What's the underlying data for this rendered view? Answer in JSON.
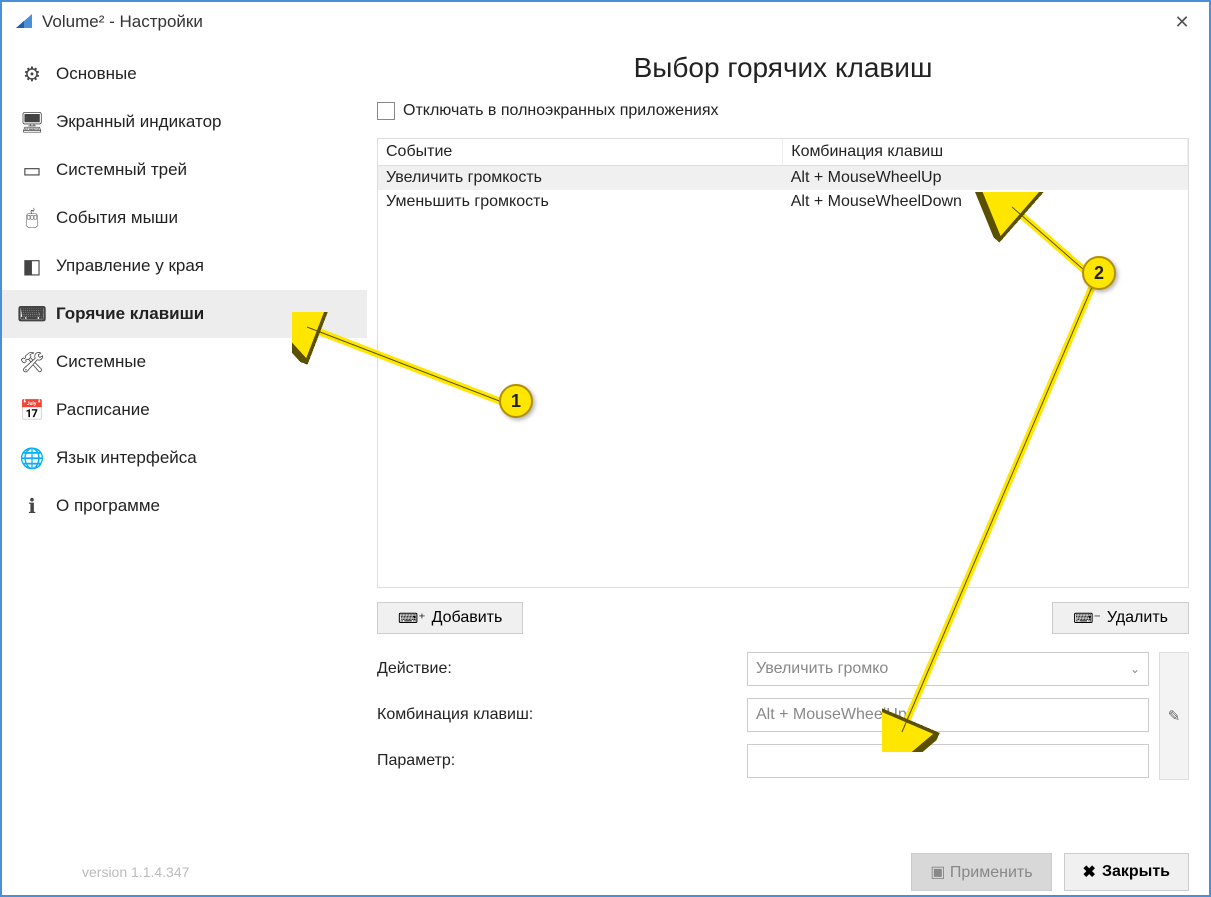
{
  "window": {
    "title": "Volume² - Настройки"
  },
  "sidebar": {
    "items": [
      {
        "label": "Основные",
        "icon": "gear"
      },
      {
        "label": "Экранный индикатор",
        "icon": "monitor"
      },
      {
        "label": "Системный трей",
        "icon": "tray"
      },
      {
        "label": "События мыши",
        "icon": "mouse"
      },
      {
        "label": "Управление у края",
        "icon": "edge"
      },
      {
        "label": "Горячие клавиши",
        "icon": "keyboard"
      },
      {
        "label": "Системные",
        "icon": "tools"
      },
      {
        "label": "Расписание",
        "icon": "calendar"
      },
      {
        "label": "Язык интерфейса",
        "icon": "globe"
      },
      {
        "label": "О программе",
        "icon": "info"
      }
    ]
  },
  "main": {
    "title": "Выбор горячих клавиш",
    "disable_fullscreen_label": "Отключать в полноэкранных приложениях",
    "table": {
      "col_event": "Событие",
      "col_combo": "Комбинация клавиш",
      "rows": [
        {
          "event": "Увеличить громкость",
          "combo": "Alt + MouseWheelUp"
        },
        {
          "event": "Уменьшить громкость",
          "combo": "Alt + MouseWheelDown"
        }
      ]
    },
    "add_label": "Добавить",
    "delete_label": "Удалить",
    "form": {
      "action_label": "Действие:",
      "action_value": "Увеличить громко",
      "combo_label": "Комбинация клавиш:",
      "combo_value": "Alt + MouseWheelUp",
      "param_label": "Параметр:",
      "param_value": ""
    }
  },
  "footer": {
    "version": "version 1.1.4.347",
    "apply_label": "Применить",
    "close_label": "Закрыть"
  },
  "annotations": {
    "callout1": "1",
    "callout2": "2"
  }
}
